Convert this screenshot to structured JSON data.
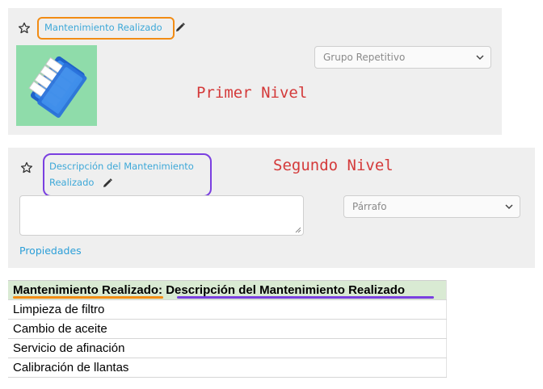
{
  "level1": {
    "field_title": "Mantenimiento Realizado",
    "select_value": "Grupo Repetitivo",
    "annotation": "Primer Nivel",
    "icon": "folder-files-icon"
  },
  "level2": {
    "field_title_line1": "Descripción del Mantenimiento",
    "field_title_line2": "Realizado",
    "select_value": "Párrafo",
    "annotation": "Segundo Nivel",
    "properties_link": "Propiedades"
  },
  "table": {
    "header_part1": "Mantenimiento Realizado:",
    "header_part2": "Descripción del Mantenimiento Realizado",
    "rows": [
      "Limpieza de filtro",
      "Cambio de aceite",
      "Servicio de afinación",
      "Calibración de llantas"
    ]
  },
  "colors": {
    "highlight_level1": "#f28c14",
    "highlight_level2": "#7a3fe0",
    "annotation": "#d43a3a",
    "link": "#2d9fd8",
    "table_header_bg": "#d9ead3"
  }
}
